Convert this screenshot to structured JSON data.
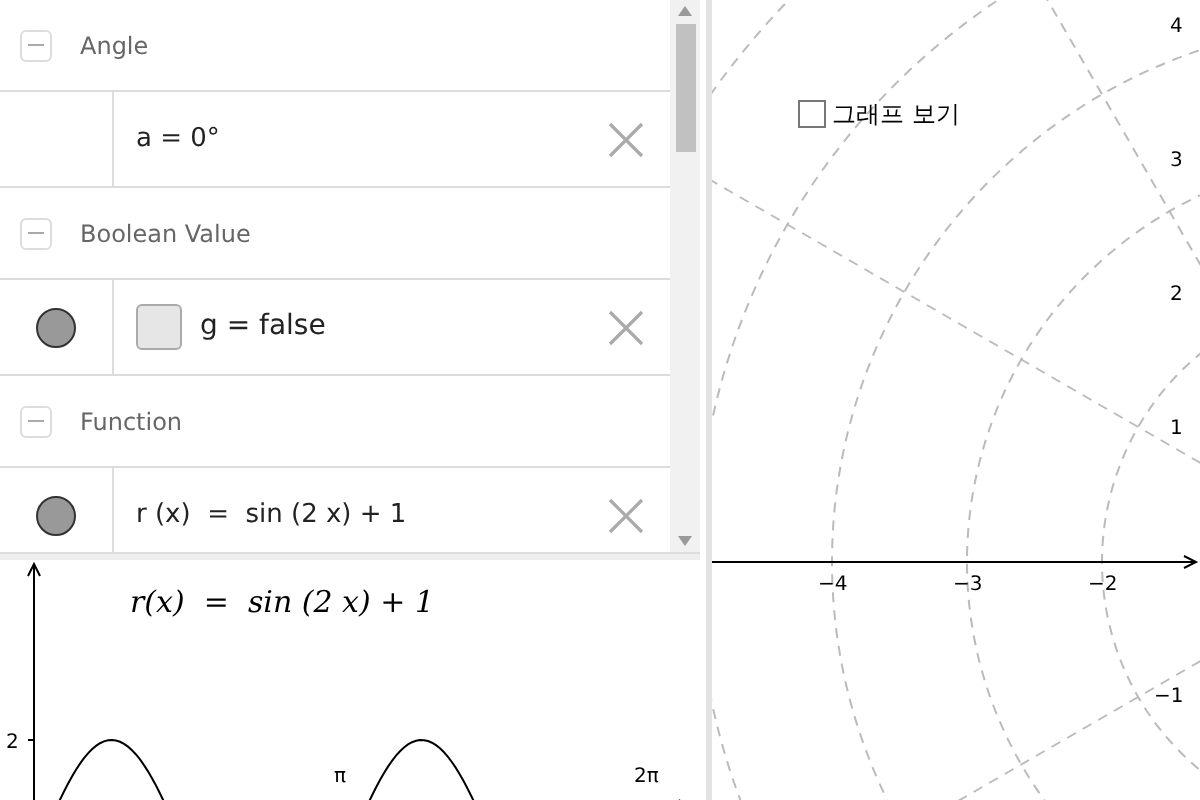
{
  "algebra_view": {
    "groups": [
      {
        "header": "Angle",
        "expanded": true,
        "items": [
          {
            "kind": "plain",
            "text": "a = 0°"
          }
        ]
      },
      {
        "header": "Boolean Value",
        "expanded": true,
        "items": [
          {
            "kind": "boolean",
            "visible": true,
            "checked": false,
            "text": "g = false"
          }
        ]
      },
      {
        "header": "Function",
        "expanded": true,
        "items": [
          {
            "kind": "plain",
            "visible": true,
            "text": "r (x)  =  sin (2 x) + 1"
          }
        ]
      }
    ]
  },
  "graphics_2": {
    "formula": "r(x)  =  sin (2 x) + 1",
    "y_ticks": [
      "2"
    ],
    "x_ticks": [
      "π",
      "2π"
    ]
  },
  "graphics_1": {
    "checkbox": {
      "label": "그래프 보기",
      "checked": false
    },
    "x_ticks": [
      "−4",
      "−3",
      "−2"
    ],
    "y_ticks": [
      "4",
      "3",
      "2",
      "1",
      "−1"
    ]
  }
}
